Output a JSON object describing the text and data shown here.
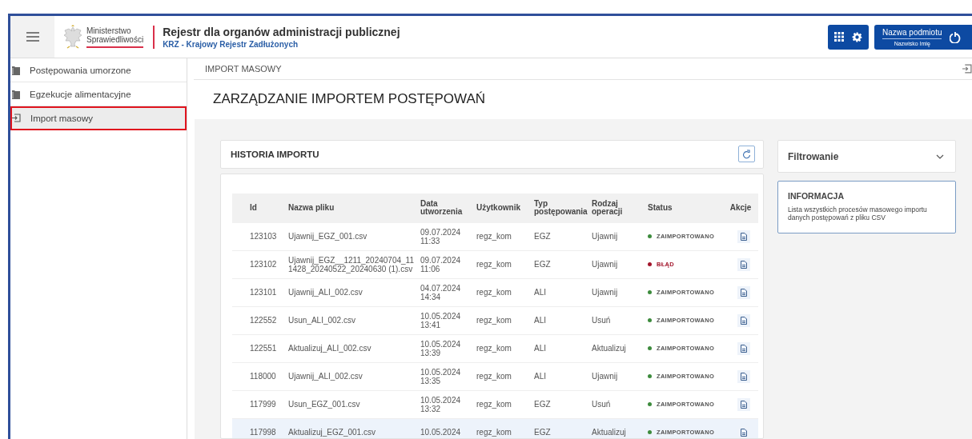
{
  "header": {
    "ministry_lines": [
      "Ministerstwo",
      "Sprawiedliwości"
    ],
    "title": "Rejestr dla organów administracji publicznej",
    "subtitle": "KRZ - Krajowy Rejestr Zadłużonych",
    "user": {
      "entity": "Nazwa podmiotu",
      "name": "Nazwisko Imię"
    }
  },
  "sidebar": {
    "items": [
      {
        "label": "Postępowania umorzone",
        "kind": "folder",
        "selected": false
      },
      {
        "label": "Egzekucje alimentacyjne",
        "kind": "folder",
        "selected": false
      },
      {
        "label": "Import masowy",
        "kind": "import",
        "selected": true
      }
    ]
  },
  "breadcrumb": "IMPORT MASOWY",
  "page_title": "ZARZĄDZANIE IMPORTEM POSTĘPOWAŃ",
  "history": {
    "title": "HISTORIA IMPORTU",
    "columns": [
      "Id",
      "Nazwa pliku",
      "Data utworzenia",
      "Użytkownik",
      "Typ postępowania",
      "Rodzaj operacji",
      "Status",
      "Akcje"
    ],
    "rows": [
      {
        "id": "123103",
        "file": "Ujawnij_EGZ_001.csv",
        "date": "09.07.2024",
        "time": "11:33",
        "user": "regz_kom",
        "type": "EGZ",
        "operation": "Ujawnij",
        "status": "ZAIMPORTOWANO",
        "color": "#3d8b3d",
        "selected": false
      },
      {
        "id": "123102",
        "file": "Ujawnij_EGZ__1211_20240704_111428_20240522_20240630 (1).csv",
        "date": "09.07.2024",
        "time": "11:06",
        "user": "regz_kom",
        "type": "EGZ",
        "operation": "Ujawnij",
        "status": "BŁĄD",
        "color": "#a3162c",
        "selected": false
      },
      {
        "id": "123101",
        "file": "Ujawnij_ALI_002.csv",
        "date": "04.07.2024",
        "time": "14:34",
        "user": "regz_kom",
        "type": "ALI",
        "operation": "Ujawnij",
        "status": "ZAIMPORTOWANO",
        "color": "#3d8b3d",
        "selected": false
      },
      {
        "id": "122552",
        "file": "Usun_ALI_002.csv",
        "date": "10.05.2024",
        "time": "13:41",
        "user": "regz_kom",
        "type": "ALI",
        "operation": "Usuń",
        "status": "ZAIMPORTOWANO",
        "color": "#3d8b3d",
        "selected": false
      },
      {
        "id": "122551",
        "file": "Aktualizuj_ALI_002.csv",
        "date": "10.05.2024",
        "time": "13:39",
        "user": "regz_kom",
        "type": "ALI",
        "operation": "Aktualizuj",
        "status": "ZAIMPORTOWANO",
        "color": "#3d8b3d",
        "selected": false
      },
      {
        "id": "118000",
        "file": "Ujawnij_ALI_002.csv",
        "date": "10.05.2024",
        "time": "13:35",
        "user": "regz_kom",
        "type": "ALI",
        "operation": "Ujawnij",
        "status": "ZAIMPORTOWANO",
        "color": "#3d8b3d",
        "selected": false
      },
      {
        "id": "117999",
        "file": "Usun_EGZ_001.csv",
        "date": "10.05.2024",
        "time": "13:32",
        "user": "regz_kom",
        "type": "EGZ",
        "operation": "Usuń",
        "status": "ZAIMPORTOWANO",
        "color": "#3d8b3d",
        "selected": false
      },
      {
        "id": "117998",
        "file": "Aktualizuj_EGZ_001.csv",
        "date": "10.05.2024",
        "user": "regz_kom",
        "type": "EGZ",
        "operation": "Aktualizuj",
        "status": "ZAIMPORTOWANO",
        "color": "#3d8b3d",
        "selected": true
      }
    ]
  },
  "filter": {
    "label": "Filtrowanie",
    "expanded": false
  },
  "info": {
    "title": "INFORMACJA",
    "text": "Lista wszystkich procesów masowego importu danych postępowań z pliku CSV"
  }
}
